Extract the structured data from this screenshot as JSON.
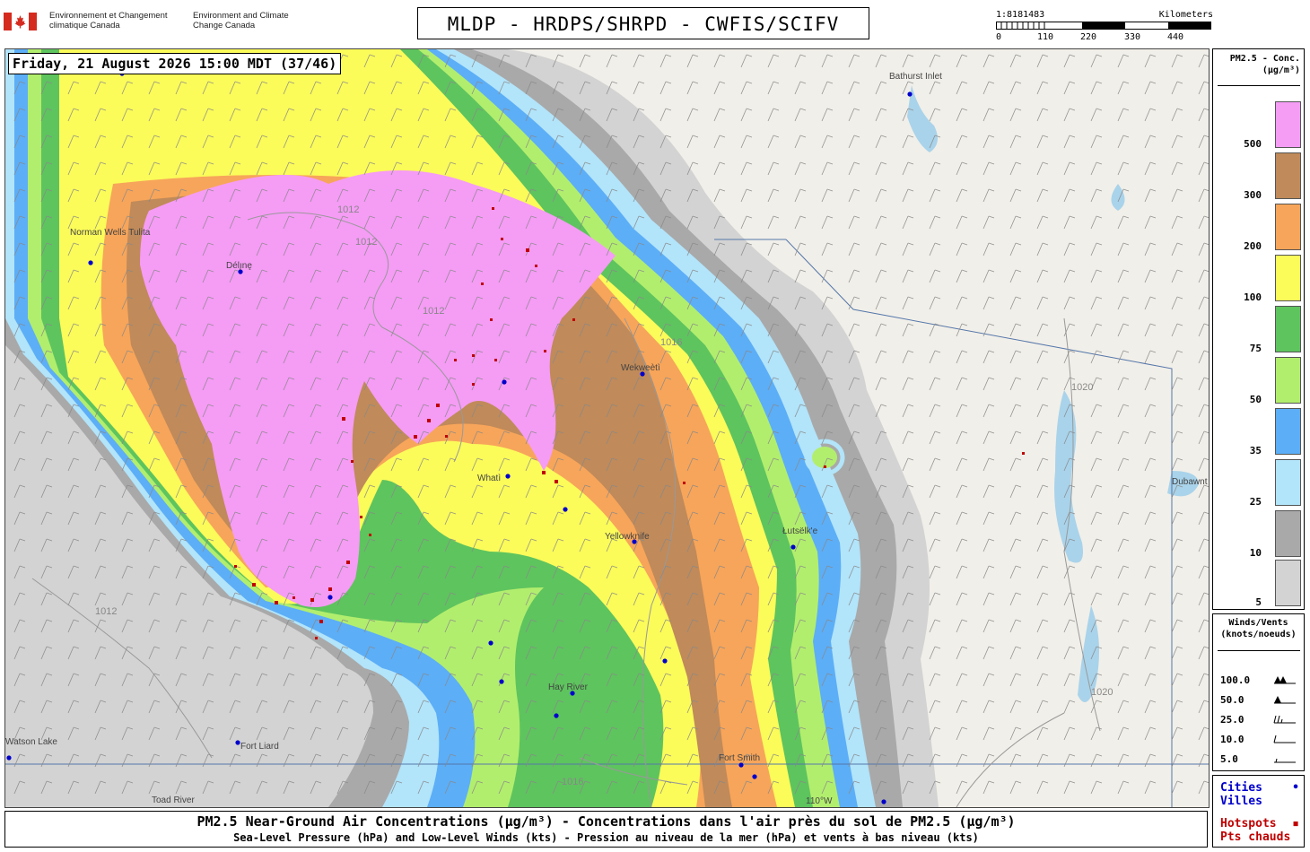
{
  "agency": {
    "name_fr": "Environnement et Changement climatique Canada",
    "name_en": "Environment and Climate Change Canada",
    "flag_icon": "canada-flag-icon"
  },
  "title": "MLDP - HRDPS/SHRPD - CWFIS/SCIFV",
  "scale": {
    "ratio": "1:8181483",
    "units": "Kilometers",
    "ticks": [
      "0",
      "110",
      "220",
      "330",
      "440"
    ]
  },
  "timestamp": "Friday, 21 August 2026 15:00 MDT (37/46)",
  "legend": {
    "title": "PM2.5 - Conc. (µg/m³)",
    "classes": [
      {
        "label": "500",
        "color": "#f59cf5"
      },
      {
        "label": "300",
        "color": "#c08a5a"
      },
      {
        "label": "200",
        "color": "#f7a55a"
      },
      {
        "label": "100",
        "color": "#fbfb5a"
      },
      {
        "label": "75",
        "color": "#5ec45e"
      },
      {
        "label": "50",
        "color": "#b2ee6e"
      },
      {
        "label": "35",
        "color": "#5caef7"
      },
      {
        "label": "25",
        "color": "#b2e4fa"
      },
      {
        "label": "10",
        "color": "#a9a9a9"
      },
      {
        "label": "5",
        "color": "#d3d3d3"
      }
    ]
  },
  "winds": {
    "title": "Winds/Vents (knots/noeuds)",
    "values": [
      "100.0",
      "50.0",
      "25.0",
      "10.0",
      "5.0"
    ]
  },
  "keys": {
    "cities_en": "Cities",
    "cities_fr": "Villes",
    "cities_color": "#0000cc",
    "hotspots_en": "Hotspots",
    "hotspots_fr": "Pts chauds",
    "hotspots_color": "#c00000"
  },
  "map": {
    "cities": [
      "Bathurst Inlet",
      "Norman Wells Tulita",
      "Délı̨nę",
      "Wekweètì",
      "Whatì",
      "Yellowknife",
      "Łutsëlk'e",
      "Hay River",
      "Fort Liard",
      "Fort Smith",
      "Toad River",
      "Watson Lake",
      "Dubawnt Lake"
    ],
    "isobars": [
      "1012",
      "1012",
      "1012",
      "1016",
      "1020",
      "1012",
      "1016",
      "1020"
    ],
    "meridian_label": "110°W"
  },
  "caption": {
    "line1": "PM2.5 Near-Ground Air Concentrations (µg/m³) - Concentrations dans l'air près du sol de PM2.5 (µg/m³)",
    "line2": "Sea-Level Pressure (hPa) and Low-Level Winds (kts) - Pression au niveau de la mer (hPa) et vents à bas niveau (kts)"
  }
}
